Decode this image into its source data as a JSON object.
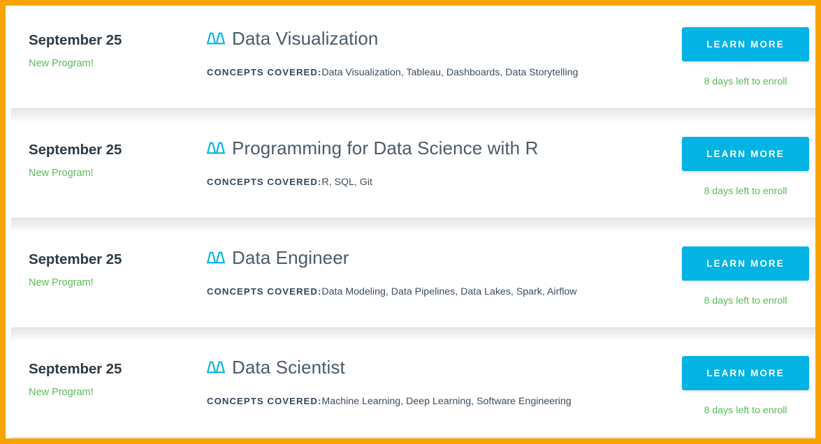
{
  "theme": {
    "frame_color": "#f7a400",
    "accent_button_color": "#02b3e4",
    "accent_green": "#5cb85c",
    "title_color": "#4a5b6b",
    "card_background": "#ffffff",
    "gap_color": "#ebecee"
  },
  "labels": {
    "concepts_label": "CONCEPTS COVERED:",
    "learn_more": "LEARN MORE",
    "brand_icon": "udacity-logo-icon"
  },
  "cards": [
    {
      "date": "September 25",
      "badge": "New Program!",
      "title": "Data Visualization",
      "concepts_label": "CONCEPTS COVERED:",
      "concepts": "Data Visualization, Tableau, Dashboards, Data Storytelling",
      "button_label": "LEARN MORE",
      "enroll_note": "8 days left to enroll"
    },
    {
      "date": "September 25",
      "badge": "New Program!",
      "title": "Programming for Data Science with R",
      "concepts_label": "CONCEPTS COVERED:",
      "concepts": "R, SQL, Git",
      "button_label": "LEARN MORE",
      "enroll_note": "8 days left to enroll"
    },
    {
      "date": "September 25",
      "badge": "New Program!",
      "title": "Data Engineer",
      "concepts_label": "CONCEPTS COVERED:",
      "concepts": "Data Modeling, Data Pipelines, Data Lakes, Spark, Airflow",
      "button_label": "LEARN MORE",
      "enroll_note": "8 days left to enroll"
    },
    {
      "date": "September 25",
      "badge": "New Program!",
      "title": "Data Scientist",
      "concepts_label": "CONCEPTS COVERED:",
      "concepts": "Machine Learning, Deep Learning, Software Engineering",
      "button_label": "LEARN MORE",
      "enroll_note": "8 days left to enroll"
    }
  ]
}
